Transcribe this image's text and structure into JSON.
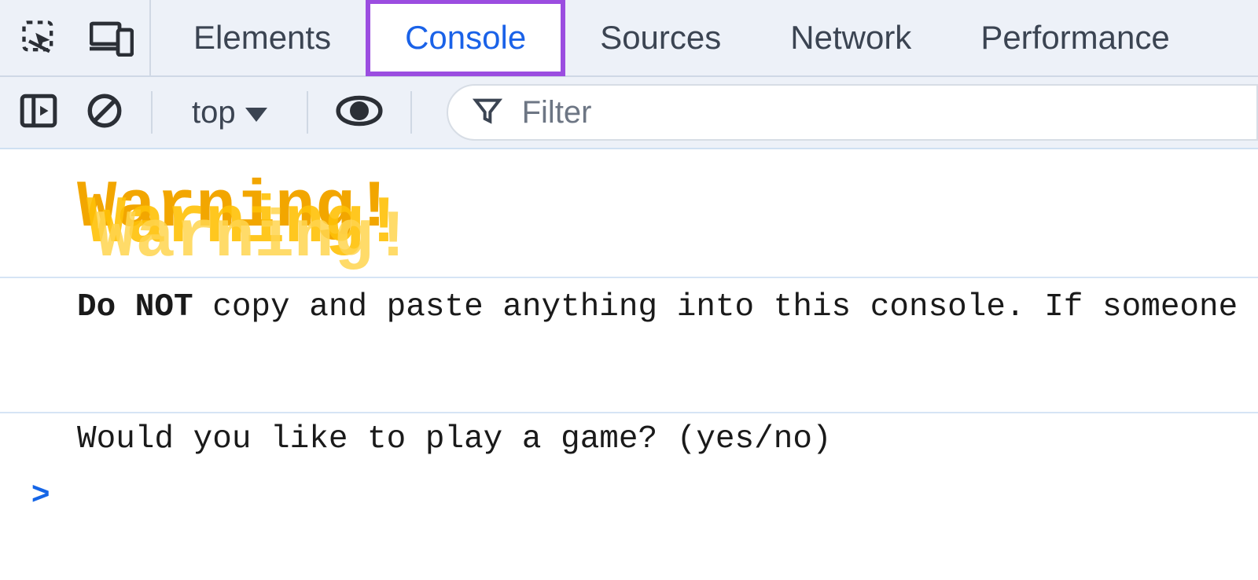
{
  "tabs": {
    "elements": "Elements",
    "console": "Console",
    "sources": "Sources",
    "network": "Network",
    "performance": "Performance",
    "active": "console"
  },
  "toolbar": {
    "context_label": "top",
    "filter_placeholder": "Filter"
  },
  "console": {
    "warning_text": "Warning!",
    "line2_bold": "Do NOT",
    "line2_rest": " copy and paste anything into this console.  If someone ",
    "line3": "Would you like to play a game? (yes/no)",
    "prompt_symbol": ">"
  },
  "icons": {
    "inspect": "inspect-element-icon",
    "device": "device-toolbar-icon",
    "sidebar": "toggle-sidebar-icon",
    "clear": "clear-console-icon",
    "eye": "live-expression-icon",
    "filter": "filter-icon"
  }
}
